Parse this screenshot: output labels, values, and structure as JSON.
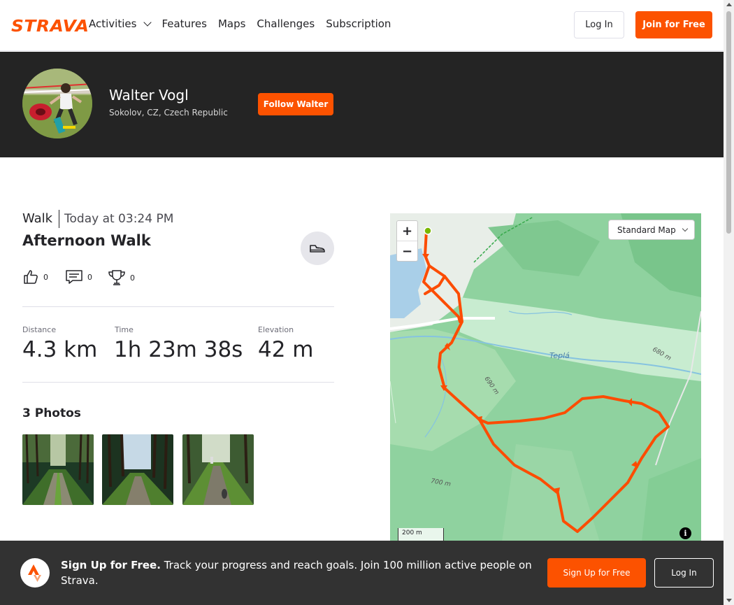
{
  "nav": {
    "logo": "STRAVA",
    "links": [
      "Activities",
      "Features",
      "Maps",
      "Challenges",
      "Subscription"
    ],
    "login_label": "Log In",
    "join_label": "Join for Free"
  },
  "athlete": {
    "name": "Walter Vogl",
    "location": "Sokolov, CZ, Czech Republic",
    "follow_label": "Follow Walter"
  },
  "activity": {
    "type": "Walk",
    "time": "Today at 03:24 PM",
    "title": "Afternoon Walk",
    "kudos_count": "0",
    "comments_count": "0",
    "achievements_count": "0",
    "stats": [
      {
        "label": "Distance",
        "value": "4.3 km"
      },
      {
        "label": "Time",
        "value": "1h 23m 38s"
      },
      {
        "label": "Elevation",
        "value": "42 m"
      }
    ]
  },
  "photos": {
    "title": "3 Photos",
    "count": 3
  },
  "map": {
    "style_label": "Standard Map",
    "zoom_in": "+",
    "zoom_out": "−",
    "scale": "200 m",
    "labels": [
      "Teplá",
      "680 m",
      "690 m",
      "700 m"
    ],
    "info": "i"
  },
  "banner": {
    "headline": "Sign Up for Free.",
    "text": "Track your progress and reach goals. Join 100 million active people on Strava.",
    "signup_label": "Sign Up for Free",
    "login_label": "Log In"
  },
  "colors": {
    "brand": "#fc5200",
    "route": "#fc4c02",
    "header_bg": "#242424",
    "banner_bg": "#323232"
  }
}
